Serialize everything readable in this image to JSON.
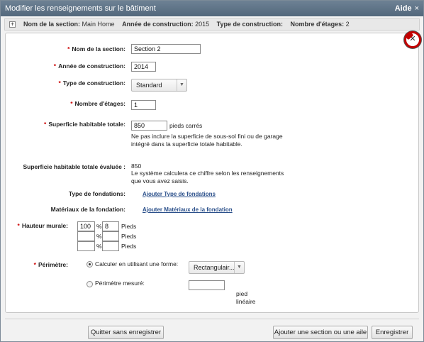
{
  "window": {
    "title": "Modifier les renseignements sur le bâtiment",
    "help_label": "Aide",
    "close_glyph": "×"
  },
  "summary": {
    "expander": "+",
    "section_label": "Nom de la section:",
    "section_value": "Main Home",
    "year_label": "Année de construction:",
    "year_value": "2015",
    "type_label": "Type de construction:",
    "type_value": "",
    "floors_label": "Nombre d'étages:",
    "floors_value": "2"
  },
  "form": {
    "section_name": {
      "label": "Nom de la section:",
      "value": "Section 2",
      "required": "*"
    },
    "year": {
      "label": "Année de construction:",
      "value": "2014",
      "required": "*"
    },
    "construction_type": {
      "label": "Type de construction:",
      "value": "Standard",
      "required": "*"
    },
    "floors": {
      "label": "Nombre d'étages:",
      "value": "1",
      "required": "*"
    },
    "living_area": {
      "label": "Superficie habitable totale:",
      "value": "850",
      "unit": "pieds carrés",
      "note": "Ne pas inclure la superficie de sous-sol fini ou de garage intégré dans la superficie totale habitable.",
      "required": "*"
    },
    "evaluated_area": {
      "label": "Superficie habitable totale évaluée :",
      "value": "850",
      "note": "Le système calculera ce chiffre selon les renseignements que vous avez saisis."
    },
    "foundation_type": {
      "label": "Type de fondations:",
      "link": "Ajouter Type de fondations"
    },
    "foundation_material": {
      "label": "Matériaux de la fondation:",
      "link": "Ajouter Matériaux de la fondation"
    },
    "wall_height": {
      "label": "Hauteur murale:",
      "required": "*",
      "rows": [
        {
          "percent": "100",
          "percent_sign": "%",
          "feet": "8",
          "unit": "Pieds"
        },
        {
          "percent": "",
          "percent_sign": "%",
          "feet": "",
          "unit": "Pieds"
        },
        {
          "percent": "",
          "percent_sign": "%",
          "feet": "",
          "unit": "Pieds"
        }
      ]
    },
    "perimeter": {
      "label": "Périmètre:",
      "required": "*",
      "option_shape": "Calculer en utilisant une forme:",
      "shape_value": "Rectangulair...",
      "option_measured": "Périmètre mesuré:",
      "measured_value": "",
      "measured_unit": "pied linéaire"
    }
  },
  "footer": {
    "quit_label": "Quitter sans enregistrer",
    "add_section_label": "Ajouter une section ou une aile",
    "save_label": "Enregistrer"
  },
  "icons": {
    "close_badge": "close-badge-icon",
    "dropdown": "chevron-down-icon"
  },
  "colors": {
    "titlebar": "#5f7489",
    "required": "#cc0000",
    "link": "#2a4f8a",
    "badge_ring": "#c20000"
  }
}
